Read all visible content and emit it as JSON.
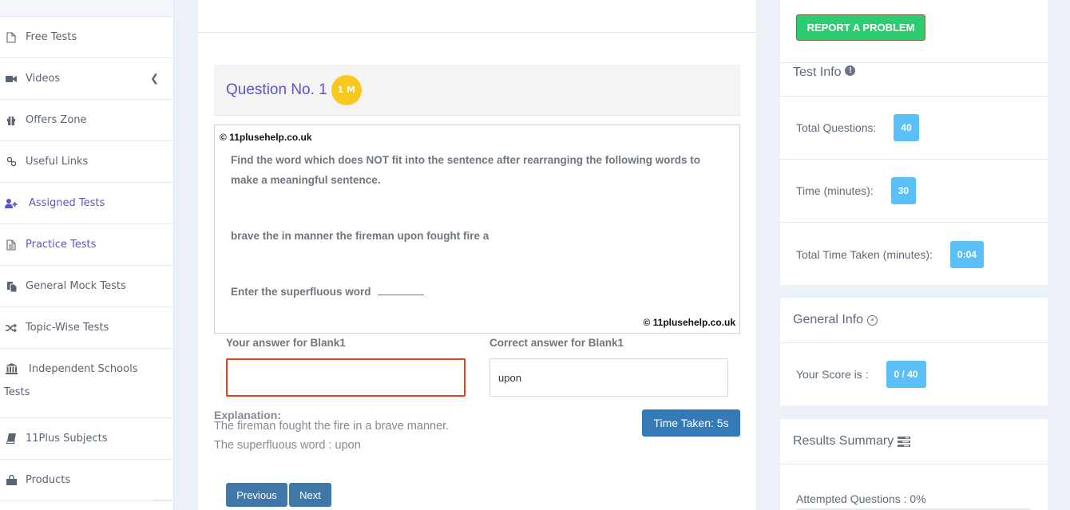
{
  "sidebar": {
    "items": [
      {
        "label": "Free Tests",
        "icon": "file-icon",
        "active": false
      },
      {
        "label": "Videos",
        "icon": "video-camera-icon",
        "active": false,
        "has_submenu": true
      },
      {
        "label": "Offers Zone",
        "icon": "gift-icon",
        "active": false
      },
      {
        "label": "Useful Links",
        "icon": "link-icon",
        "active": false
      },
      {
        "label": "Assigned Tests",
        "icon": "user-plus-icon",
        "active": true
      },
      {
        "label": "Practice Tests",
        "icon": "file-text-icon",
        "active": true
      },
      {
        "label": "General Mock Tests",
        "icon": "copy-icon",
        "active": false
      },
      {
        "label": "Topic-Wise Tests",
        "icon": "random-icon",
        "active": false
      },
      {
        "label": "Independent Schools",
        "label_cont": "Tests",
        "icon": "bank-icon",
        "active": false
      },
      {
        "label": "11Plus Subjects",
        "icon": "book-icon",
        "active": false
      },
      {
        "label": "Products",
        "icon": "shopping-bag-icon",
        "active": false
      }
    ]
  },
  "question": {
    "title": "Question No. 1",
    "marks_badge": "1 M",
    "copyright": "© 11plusehelp.co.uk",
    "instruction": "Find the word which does NOT fit into the sentence after rearranging the following words to make a meaningful sentence.",
    "words": "brave the in manner the fireman upon fought  fire a",
    "prompt": "Enter the superfluous word",
    "your_answer_label": "Your answer for Blank1",
    "your_answer_value": "",
    "correct_answer_label": "Correct answer for Blank1",
    "correct_answer_value": "upon",
    "explanation_label": "Explanation:",
    "explanation_lines": [
      "The fireman fought the fire in a brave manner.",
      "The superfluous word : upon"
    ],
    "time_taken": "Time Taken: 5s",
    "prev_label": "Previous",
    "next_label": "Next"
  },
  "right_panel": {
    "report_button": "REPORT A PROBLEM",
    "test_info": {
      "title": "Test Info",
      "rows": [
        {
          "label": "Total Questions:",
          "value": "40"
        },
        {
          "label": "Time (minutes):",
          "value": "30"
        },
        {
          "label": "Total Time Taken (minutes):",
          "value": "0:04"
        }
      ]
    },
    "general_info": {
      "title": "General Info",
      "score_label": "Your Score is :",
      "score_value": "0 / 40"
    },
    "results_summary": {
      "title": "Results Summary",
      "attempted_label": "Attempted Questions : 0%",
      "attempted_percent": 0
    }
  },
  "colors": {
    "accent": "#5a56c6",
    "badge_yellow": "#f8c81e",
    "info_pill": "#5bc0f8",
    "report_green": "#2ecc71",
    "wrong_border": "#e8401c",
    "button_blue": "#337ab7"
  }
}
